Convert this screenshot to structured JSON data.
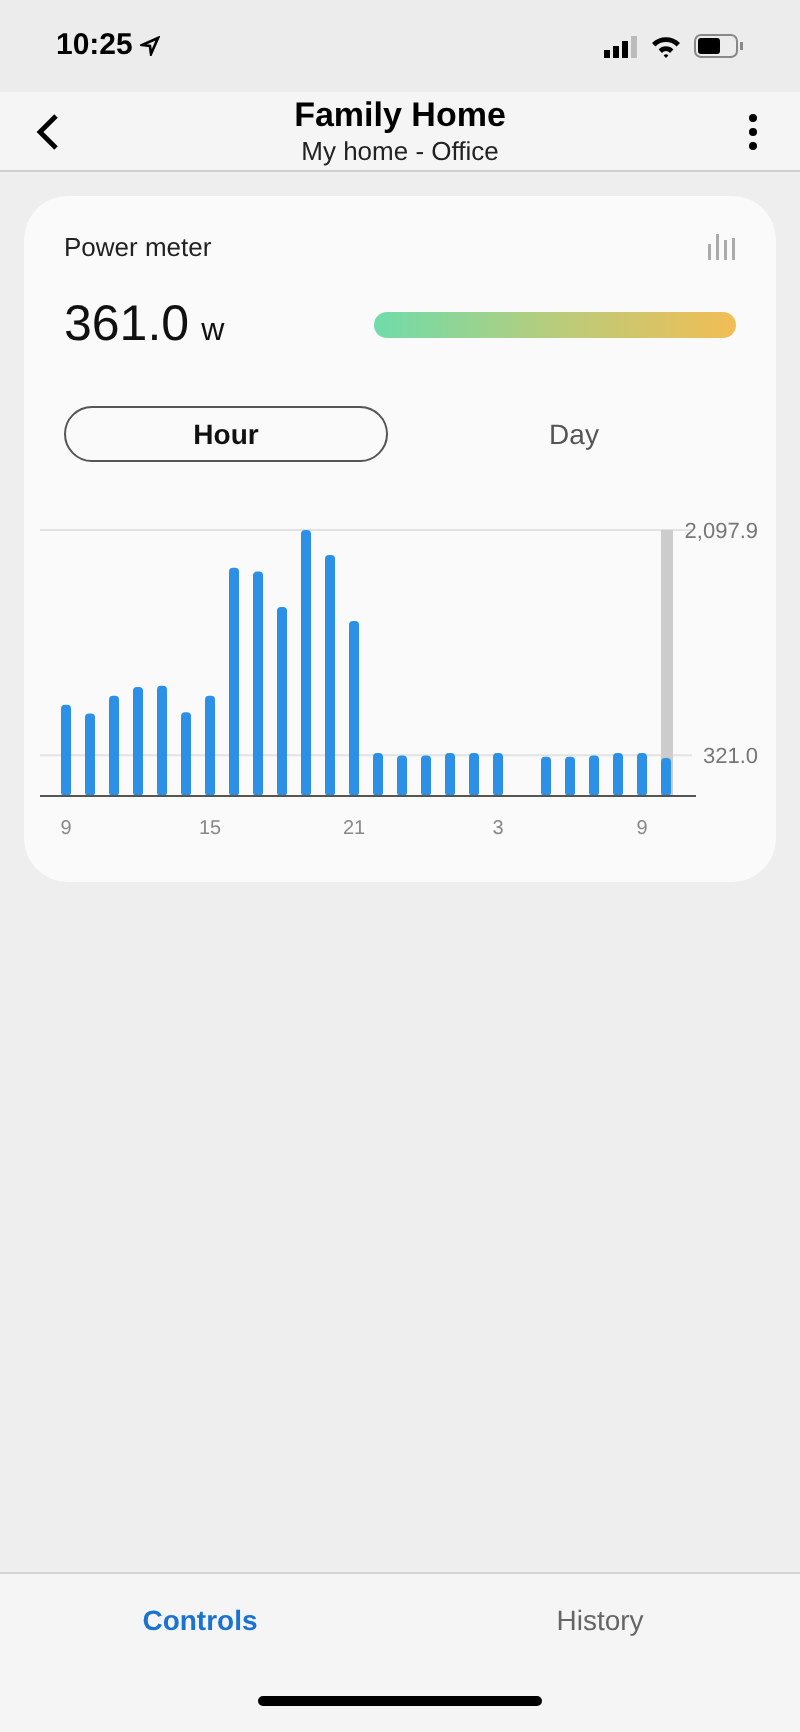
{
  "status_bar": {
    "time": "10:25"
  },
  "header": {
    "title": "Family Home",
    "subtitle": "My home - Office"
  },
  "card": {
    "title": "Power meter",
    "reading": "361.0",
    "unit": "w",
    "tabs": [
      {
        "label": "Hour",
        "selected": true
      },
      {
        "label": "Day",
        "selected": false
      }
    ],
    "chart_data": {
      "type": "bar",
      "categories": [
        "9",
        null,
        null,
        null,
        null,
        null,
        "15",
        null,
        null,
        null,
        null,
        null,
        "21",
        null,
        null,
        null,
        null,
        null,
        "3",
        null,
        null,
        null,
        null,
        null,
        "9",
        null
      ],
      "series": [
        {
          "color": "#2b90e6",
          "values": [
            720,
            650,
            790,
            860,
            870,
            660,
            790,
            1800,
            1770,
            1490,
            2097.9,
            1900,
            1380,
            340,
            320,
            320,
            340,
            340,
            340,
            null,
            310,
            310,
            320,
            340,
            340,
            300
          ]
        }
      ],
      "ylim": [
        0,
        2097.9
      ],
      "yticks": [
        {
          "value": 321,
          "label": "321.0"
        },
        {
          "value": 2097.9,
          "label": "2,097.9"
        }
      ]
    }
  },
  "bottom_tabs": [
    {
      "label": "Controls",
      "selected": true
    },
    {
      "label": "History",
      "selected": false
    }
  ]
}
